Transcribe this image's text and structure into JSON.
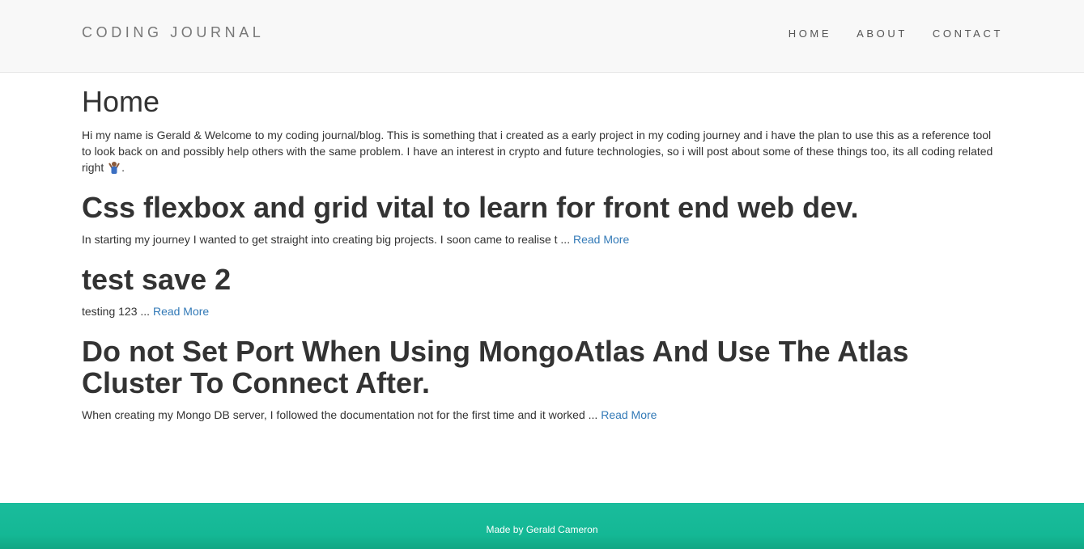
{
  "navbar": {
    "brand": "CODING JOURNAL",
    "links": [
      "HOME",
      "ABOUT",
      "CONTACT"
    ]
  },
  "page": {
    "heading": "Home",
    "intro": "Hi my name is Gerald & Welcome to my coding journal/blog. This is something that i created as a early project in my coding journey and i have the plan to use this as a reference tool to look back on and possibly help others with the same problem. I have an interest in crypto and future technologies, so i will post about some of these things too, its all coding related right ",
    "intro_end": "."
  },
  "posts": [
    {
      "title": "Css flexbox and grid vital to learn for front end web dev.",
      "excerpt": "In starting my journey I wanted to get straight into creating big projects. I soon came to realise t ... ",
      "link": "Read More"
    },
    {
      "title": "test save 2",
      "excerpt": "testing 123 ... ",
      "link": "Read More"
    },
    {
      "title": "Do not Set Port When Using MongoAtlas And Use The Atlas Cluster To Connect After.",
      "excerpt": "When creating my Mongo DB server, I followed the documentation not for the first time and it worked ... ",
      "link": "Read More"
    }
  ],
  "footer": {
    "text": "Made by Gerald Cameron"
  },
  "colors": {
    "footer_bg": "#1abc9c",
    "link": "#337ab7",
    "navbar_bg": "#f8f8f8"
  },
  "icons": {
    "intro_emoji": "person-shrugging-icon"
  }
}
